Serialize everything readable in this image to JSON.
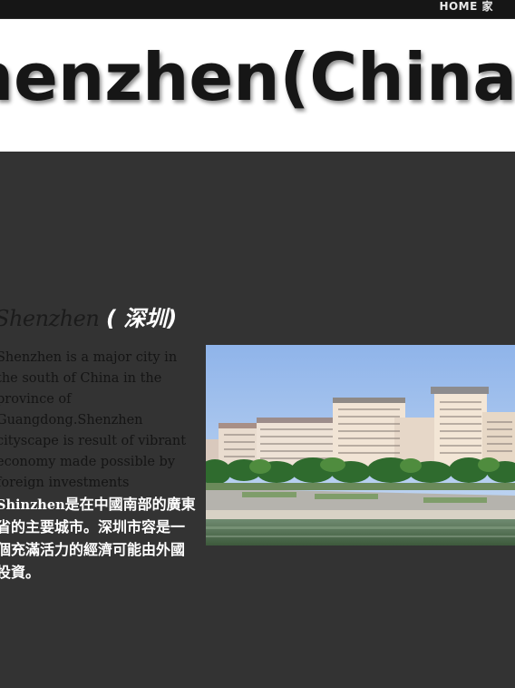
{
  "nav": {
    "home_label": "HOME 家"
  },
  "banner": {
    "title": "Shenzhen(China) 深圳"
  },
  "article": {
    "heading_en": "Shenzhen",
    "heading_cn": "( 深圳)",
    "body_en_start": "Shenzhen is a major city in the south of China in the province of Guangdong.Shenzhen cityscape is result of vibrant economy made possible by foreign investments ",
    "highlight": "Shinzhen",
    "body_cn": "是在中國南部的廣東省的主要城市。深圳市容是一個充滿活力的經濟可能由外國投資。"
  },
  "colors": {
    "background": "#333333",
    "topbar": "#161616",
    "banner": "#ffffff",
    "text_dark": "#141414",
    "text_light": "#ffffff"
  },
  "icons": []
}
